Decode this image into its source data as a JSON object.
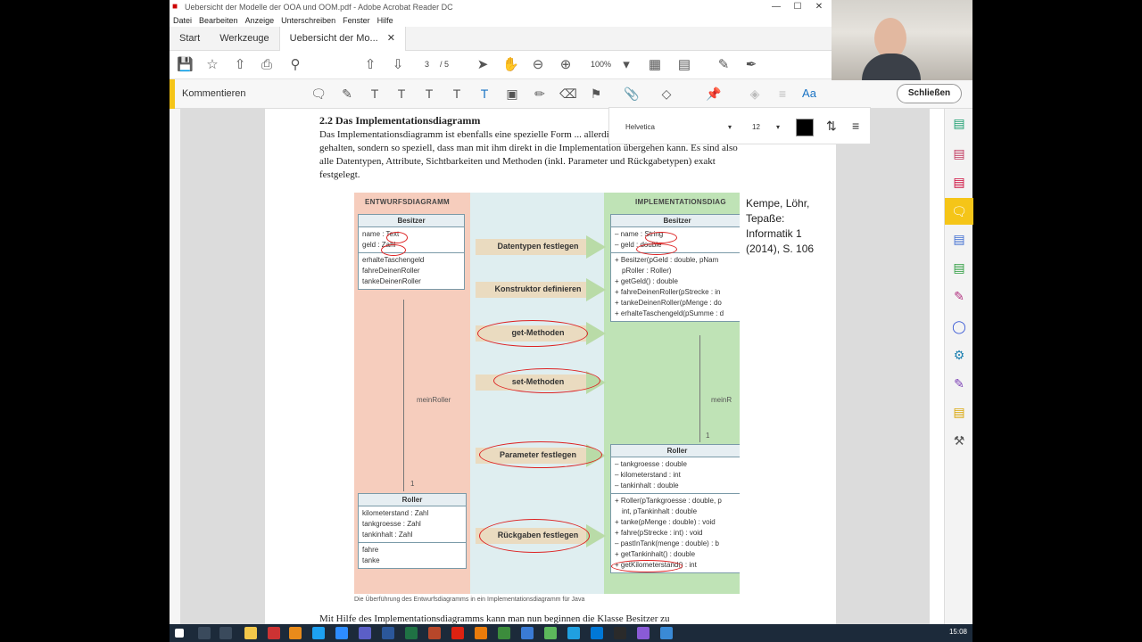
{
  "window": {
    "title": "Uebersicht der Modelle der OOA und OOM.pdf - Adobe Acrobat Reader DC"
  },
  "menu": [
    "Datei",
    "Bearbeiten",
    "Anzeige",
    "Unterschreiben",
    "Fenster",
    "Hilfe"
  ],
  "tabs": {
    "start": "Start",
    "tools": "Werkzeuge",
    "doc": "Uebersicht der Mo..."
  },
  "toolbar": {
    "page_current": "3",
    "page_total": "/ 5",
    "zoom": "100%"
  },
  "comment": {
    "label": "Kommentieren",
    "close": "Schließen",
    "font": "Helvetica",
    "size": "12",
    "color": "#000000"
  },
  "doc": {
    "heading": "2.2 Das Implementationsdiagramm",
    "paragraph": "Das Implementationsdiagramm ist ebenfalls eine spezielle Form ... allerdings nicht mehr allgemein gehalten, sondern so speziell, dass man mit ihm direkt in die Implementation übergehen kann. Es sind also alle Datentypen, Attribute, Sichtbarkeiten und Methoden (inkl. Parameter und Rückgabetypen) exakt festgelegt.",
    "paragraph2": "Mit Hilfe des Implementationsdiagramms kann man nun beginnen die Klasse Besitzer zu",
    "citation": [
      "Kempe, Löhr,",
      "Tepaße:",
      "Informatik 1",
      "(2014), S. 106"
    ]
  },
  "figure": {
    "left_title": "ENTWURFSDIAGRAMM",
    "right_title": "IMPLEMENTATIONSDIAG",
    "caption": "Die Überführung des Entwurfsdiagramms in ein Implementationsdiagramm für Java",
    "left_besitzer": {
      "name": "Besitzer",
      "attrs": [
        "name : Text",
        "geld : Zahl"
      ],
      "methods": [
        "erhalteTaschengeld",
        "fahreDeinenRoller",
        "tankeDeinenRoller"
      ]
    },
    "left_roller": {
      "name": "Roller",
      "attrs": [
        "kilometerstand : Zahl",
        "tankgroesse : Zahl",
        "tankinhalt : Zahl"
      ],
      "methods": [
        "fahre",
        "tanke"
      ]
    },
    "right_besitzer": {
      "name": "Besitzer",
      "attrs": [
        "– name : String",
        "– geld : double"
      ],
      "methods": [
        "+ Besitzer(pGeld : double, pNam",
        "pRoller : Roller)",
        "+ getGeld() : double",
        "+ fahreDeinenRoller(pStrecke : in",
        "+ tankeDeinenRoller(pMenge : do",
        "+ erhalteTaschengeld(pSumme : d"
      ]
    },
    "right_roller": {
      "name": "Roller",
      "attrs": [
        "– tankgroesse : double",
        "– kilometerstand : int",
        "– tankinhalt : double"
      ],
      "methods": [
        "+ Roller(pTankgroesse : double, p",
        "int, pTankinhalt : double",
        "+ tanke(pMenge : double) : void",
        "+ fahre(pStrecke : int) : void",
        "– pastInTank(menge : double) : b",
        "+ getTankinhalt() : double",
        "+ getKilometerstand() : int"
      ]
    },
    "arrows": [
      "Datentypen festlegen",
      "Konstruktor definieren",
      "get-Methoden",
      "set-Methoden",
      "Parameter festlegen",
      "Rückgaben festlegen"
    ],
    "assoc_left": "meinRoller",
    "assoc_right": "meinR",
    "mult_left": "1",
    "mult_right": "1"
  },
  "taskbar": {
    "time": "15:08"
  }
}
